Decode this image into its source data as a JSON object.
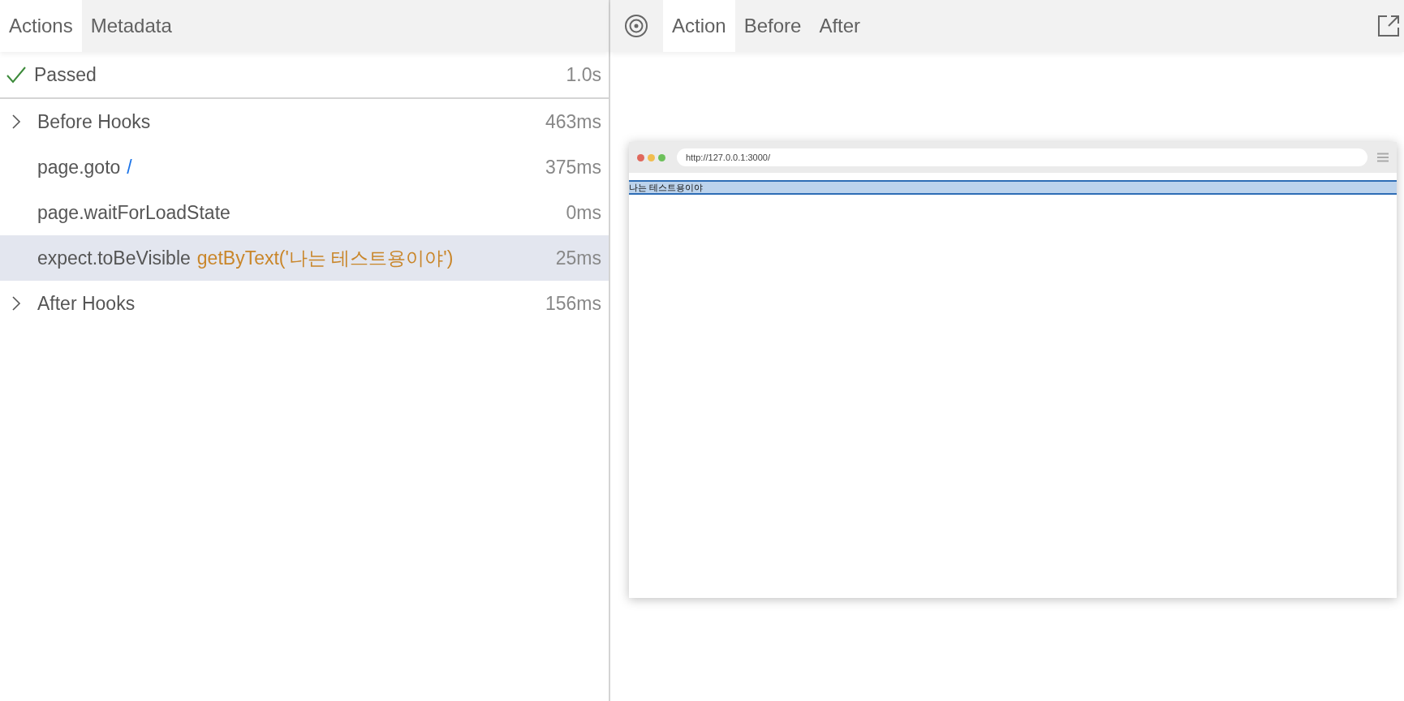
{
  "left_tabs": [
    {
      "label": "Actions",
      "selected": true
    },
    {
      "label": "Metadata",
      "selected": false
    }
  ],
  "status": {
    "label": "Passed",
    "passed": true,
    "duration": "1.0s"
  },
  "actions": [
    {
      "title": "Before Hooks",
      "expandable": true,
      "selected": false,
      "duration": "463ms"
    },
    {
      "title": "page.goto",
      "param": {
        "text": "/",
        "kind": "url"
      },
      "expandable": false,
      "selected": false,
      "duration": "375ms"
    },
    {
      "title": "page.waitForLoadState",
      "expandable": false,
      "selected": false,
      "duration": "0ms"
    },
    {
      "title": "expect.toBeVisible",
      "param": {
        "text": "getByText('나는 테스트용이야')",
        "kind": "locator"
      },
      "expandable": false,
      "selected": true,
      "duration": "25ms"
    },
    {
      "title": "After Hooks",
      "expandable": true,
      "selected": false,
      "duration": "156ms"
    }
  ],
  "right_tabs": [
    {
      "label": "Action",
      "selected": true
    },
    {
      "label": "Before",
      "selected": false
    },
    {
      "label": "After",
      "selected": false
    }
  ],
  "snapshot": {
    "url": "http://127.0.0.1:3000/",
    "highlighted_text": "나는 테스트용이야"
  }
}
